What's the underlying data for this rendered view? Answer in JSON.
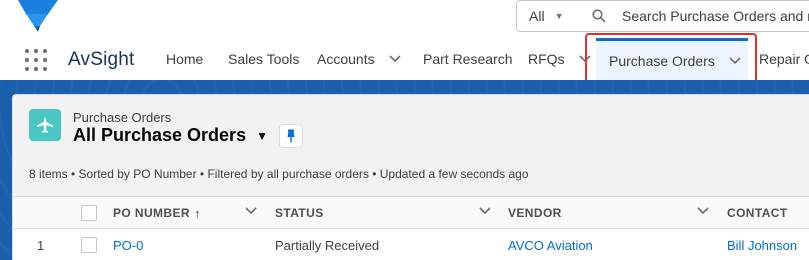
{
  "header": {
    "search_scope": "All",
    "search_placeholder": "Search Purchase Orders and m"
  },
  "nav": {
    "app_name": "AvSight",
    "items": [
      {
        "label": "Home"
      },
      {
        "label": "Sales Tools"
      },
      {
        "label": "Accounts"
      },
      {
        "label": "Part Research"
      },
      {
        "label": "RFQs"
      },
      {
        "label": "Purchase Orders"
      },
      {
        "label": "Repair O"
      }
    ]
  },
  "list_view": {
    "object_label": "Purchase Orders",
    "title": "All Purchase Orders",
    "meta": "8 items • Sorted by PO Number • Filtered by all purchase orders • Updated a few seconds ago"
  },
  "table": {
    "columns": [
      "PO Number",
      "Status",
      "Vendor",
      "Contact"
    ],
    "sort_indicator": "↑",
    "rows": [
      {
        "num": "1",
        "po_number": "PO-0",
        "status": "Partially Received",
        "vendor": "AVCO Aviation",
        "contact": "Bill Johnson"
      }
    ]
  },
  "colors": {
    "brand_blue": "#1b5fad",
    "active_tab_bg": "#eef4ff",
    "active_tab_bar": "#0070d2",
    "link": "#006dcc",
    "annotation_red": "#e0302a",
    "object_icon": "#4bc7c3"
  },
  "icons": {
    "logo": "avsight-logo-icon",
    "waffle": "app-launcher-icon",
    "search": "search-icon",
    "object": "airplane-icon",
    "pin": "pin-icon"
  }
}
